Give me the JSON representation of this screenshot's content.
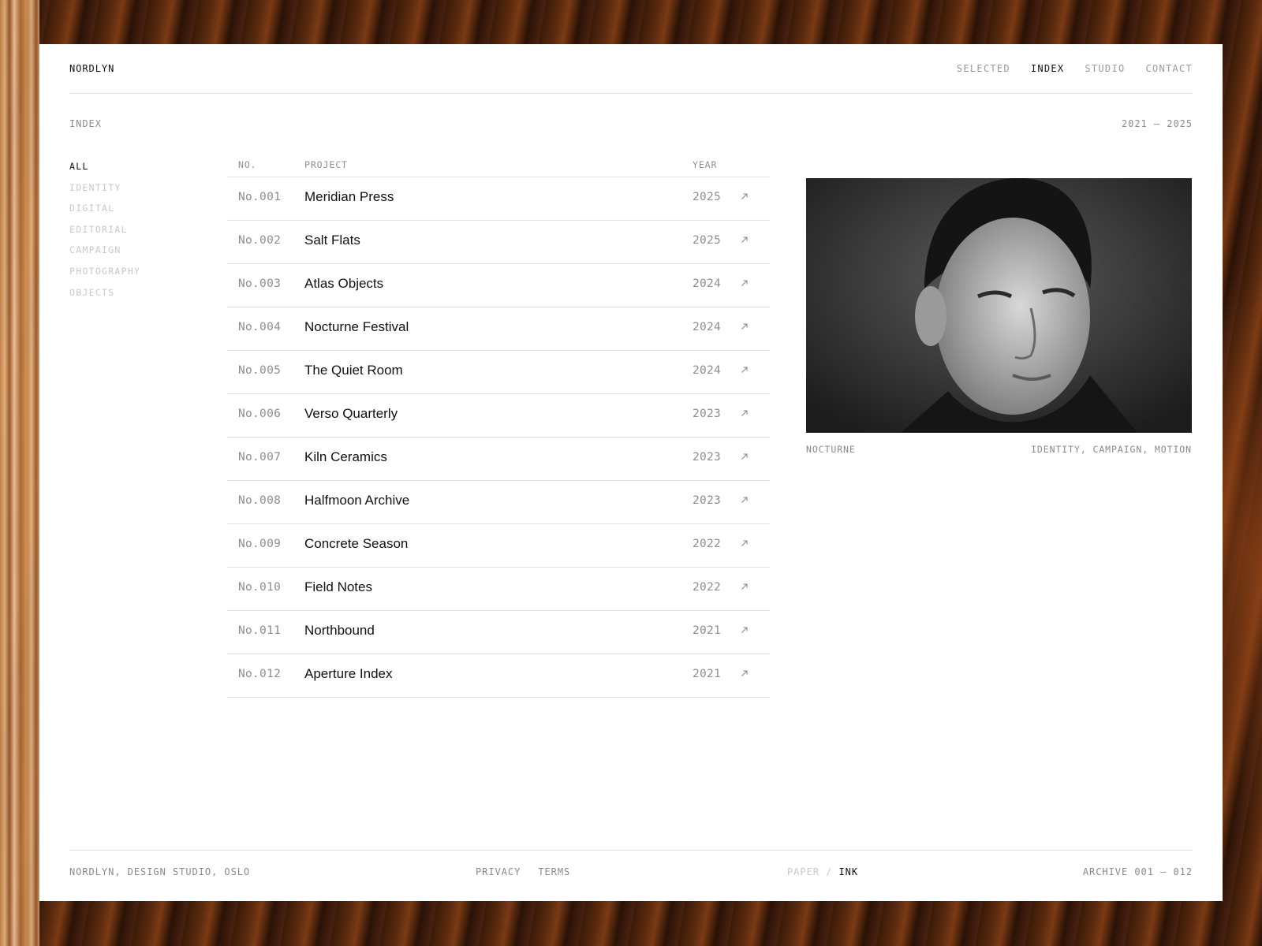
{
  "header": {
    "brand": "NORDLYN",
    "nav": [
      {
        "label": "SELECTED",
        "active": false
      },
      {
        "label": "INDEX",
        "active": true
      },
      {
        "label": "STUDIO",
        "active": false
      },
      {
        "label": "CONTACT",
        "active": false
      }
    ]
  },
  "subhead": {
    "title": "INDEX",
    "range": "2021 – 2025"
  },
  "filters": [
    {
      "label": "ALL",
      "active": true
    },
    {
      "label": "IDENTITY",
      "active": false
    },
    {
      "label": "DIGITAL",
      "active": false
    },
    {
      "label": "EDITORIAL",
      "active": false
    },
    {
      "label": "CAMPAIGN",
      "active": false
    },
    {
      "label": "PHOTOGRAPHY",
      "active": false
    },
    {
      "label": "OBJECTS",
      "active": false
    }
  ],
  "table": {
    "columns": {
      "no": "NO.",
      "project": "PROJECT",
      "year": "YEAR"
    },
    "rows": [
      {
        "no": "No.001",
        "project": "Meridian Press",
        "year": "2025"
      },
      {
        "no": "No.002",
        "project": "Salt Flats",
        "year": "2025"
      },
      {
        "no": "No.003",
        "project": "Atlas Objects",
        "year": "2024"
      },
      {
        "no": "No.004",
        "project": "Nocturne Festival",
        "year": "2024"
      },
      {
        "no": "No.005",
        "project": "The Quiet Room",
        "year": "2024"
      },
      {
        "no": "No.006",
        "project": "Verso Quarterly",
        "year": "2023"
      },
      {
        "no": "No.007",
        "project": "Kiln Ceramics",
        "year": "2023"
      },
      {
        "no": "No.008",
        "project": "Halfmoon Archive",
        "year": "2023"
      },
      {
        "no": "No.009",
        "project": "Concrete Season",
        "year": "2022"
      },
      {
        "no": "No.010",
        "project": "Field Notes",
        "year": "2022"
      },
      {
        "no": "No.011",
        "project": "Northbound",
        "year": "2021"
      },
      {
        "no": "No.012",
        "project": "Aperture Index",
        "year": "2021"
      }
    ]
  },
  "preview": {
    "name": "NOCTURNE",
    "tags": "IDENTITY, CAMPAIGN, MOTION"
  },
  "footer": {
    "studio": "NORDLYN, DESIGN STUDIO, OSLO",
    "privacy": "PRIVACY",
    "terms": "TERMS",
    "theme_paper": "PAPER",
    "theme_sep": "/",
    "theme_ink": "INK",
    "archive": "ARCHIVE 001 – 012"
  },
  "colors": {
    "ink": "#111111",
    "muted": "#8a8a8a",
    "faint": "#c9c9c9",
    "rule": "#dedede"
  }
}
